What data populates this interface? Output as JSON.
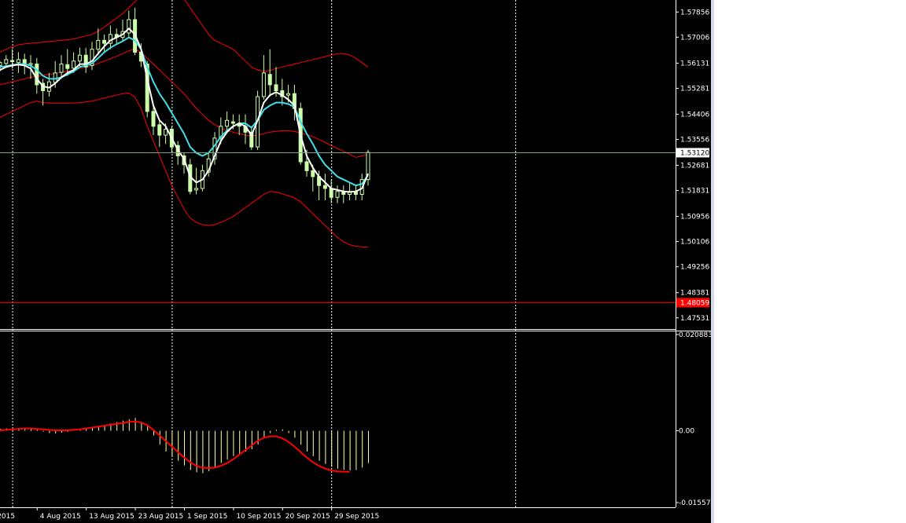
{
  "colors": {
    "background": "#000000",
    "foreground": "#ffffff",
    "grid": "#ffffff",
    "bull_candle": "#ccffaa",
    "bear_candle": "#ccffaa",
    "bollinger": "#ff0000",
    "ma_fast": "#ffffff",
    "ma_slow": "#40e0e8",
    "bid_line": "#7aa57a",
    "alert_line": "#ff0000",
    "alert_label_bg": "#ff0000",
    "bid_label_bg": "#ffffff",
    "macd_hist": "#ffffaa",
    "macd_signal": "#ff0000"
  },
  "chart_data": [
    {
      "type": "candlestick",
      "ylim": [
        1.4718,
        1.5805
      ],
      "price_ticks": [
        "1.57856",
        "1.57006",
        "1.56131",
        "1.55281",
        "1.54406",
        "1.53556",
        "1.52681",
        "1.51831",
        "1.50956",
        "1.50106",
        "1.49256",
        "1.48381",
        "1.47531"
      ],
      "bid_price": "1.53120",
      "alert_price": "1.48059",
      "x_labels": [
        {
          "text": "2015",
          "index": -1
        },
        {
          "text": "4 Aug 2015",
          "index": 6
        },
        {
          "text": "13 Aug 2015",
          "index": 14
        },
        {
          "text": "23 Aug 2015",
          "index": 22
        },
        {
          "text": "1 Sep 2015",
          "index": 30
        },
        {
          "text": "10 Sep 2015",
          "index": 38
        },
        {
          "text": "20 Sep 2015",
          "index": 46
        },
        {
          "text": "29 Sep 2015",
          "index": 54
        }
      ],
      "grid_indices": [
        2,
        28,
        54,
        84
      ],
      "bars": [
        [
          1.5605,
          1.5615,
          1.5585,
          1.562
        ],
        [
          1.5612,
          1.5625,
          1.56,
          1.564
        ],
        [
          1.5622,
          1.5618,
          1.5595,
          1.566
        ],
        [
          1.5615,
          1.5625,
          1.558,
          1.565
        ],
        [
          1.5625,
          1.561,
          1.5575,
          1.5645
        ],
        [
          1.5608,
          1.5612,
          1.556,
          1.564
        ],
        [
          1.561,
          1.554,
          1.551,
          1.563
        ],
        [
          1.5545,
          1.552,
          1.547,
          1.556
        ],
        [
          1.5518,
          1.555,
          1.55,
          1.558
        ],
        [
          1.5548,
          1.558,
          1.553,
          1.562
        ],
        [
          1.5582,
          1.561,
          1.556,
          1.564
        ],
        [
          1.5608,
          1.5595,
          1.557,
          1.566
        ],
        [
          1.5596,
          1.562,
          1.558,
          1.565
        ],
        [
          1.562,
          1.564,
          1.56,
          1.5665
        ],
        [
          1.564,
          1.56,
          1.558,
          1.5665
        ],
        [
          1.5605,
          1.566,
          1.559,
          1.5685
        ],
        [
          1.566,
          1.569,
          1.564,
          1.573
        ],
        [
          1.569,
          1.568,
          1.565,
          1.571
        ],
        [
          1.568,
          1.571,
          1.566,
          1.574
        ],
        [
          1.571,
          1.57,
          1.568,
          1.573
        ],
        [
          1.57,
          1.572,
          1.569,
          1.576
        ],
        [
          1.5715,
          1.576,
          1.57,
          1.579
        ],
        [
          1.576,
          1.565,
          1.564,
          1.58
        ],
        [
          1.565,
          1.562,
          1.56,
          1.568
        ],
        [
          1.561,
          1.545,
          1.543,
          1.562
        ],
        [
          1.545,
          1.54,
          1.537,
          1.547
        ],
        [
          1.5405,
          1.537,
          1.533,
          1.542
        ],
        [
          1.537,
          1.539,
          1.534,
          1.541
        ],
        [
          1.539,
          1.533,
          1.531,
          1.54
        ],
        [
          1.5335,
          1.53,
          1.527,
          1.535
        ],
        [
          1.53,
          1.527,
          1.524,
          1.531
        ],
        [
          1.527,
          1.518,
          1.517,
          1.529
        ],
        [
          1.5185,
          1.519,
          1.517,
          1.526
        ],
        [
          1.519,
          1.525,
          1.518,
          1.527
        ],
        [
          1.5245,
          1.529,
          1.523,
          1.531
        ],
        [
          1.529,
          1.536,
          1.527,
          1.538
        ],
        [
          1.536,
          1.54,
          1.534,
          1.543
        ],
        [
          1.54,
          1.542,
          1.538,
          1.545
        ],
        [
          1.5415,
          1.541,
          1.539,
          1.544
        ],
        [
          1.541,
          1.54,
          1.537,
          1.544
        ],
        [
          1.54,
          1.538,
          1.534,
          1.544
        ],
        [
          1.538,
          1.533,
          1.532,
          1.54
        ],
        [
          1.533,
          1.55,
          1.532,
          1.552
        ],
        [
          1.55,
          1.558,
          1.549,
          1.564
        ],
        [
          1.5575,
          1.554,
          1.55,
          1.566
        ],
        [
          1.554,
          1.552,
          1.55,
          1.56
        ],
        [
          1.552,
          1.55,
          1.547,
          1.556
        ],
        [
          1.5505,
          1.551,
          1.548,
          1.554
        ],
        [
          1.551,
          1.546,
          1.542,
          1.554
        ],
        [
          1.546,
          1.528,
          1.527,
          1.548
        ],
        [
          1.528,
          1.525,
          1.523,
          1.532
        ],
        [
          1.525,
          1.523,
          1.518,
          1.527
        ],
        [
          1.523,
          1.52,
          1.515,
          1.525
        ],
        [
          1.52,
          1.519,
          1.515,
          1.524
        ],
        [
          1.519,
          1.516,
          1.514,
          1.522
        ],
        [
          1.516,
          1.518,
          1.514,
          1.52
        ],
        [
          1.518,
          1.517,
          1.514,
          1.52
        ],
        [
          1.517,
          1.518,
          1.515,
          1.521
        ],
        [
          1.518,
          1.517,
          1.515,
          1.52
        ],
        [
          1.517,
          1.522,
          1.515,
          1.524
        ],
        [
          1.522,
          1.5312,
          1.52,
          1.532
        ]
      ],
      "ma_fast": [
        1.559,
        1.56,
        1.5605,
        1.5608,
        1.5605,
        1.5595,
        1.556,
        1.5535,
        1.553,
        1.5545,
        1.5565,
        1.558,
        1.559,
        1.561,
        1.561,
        1.562,
        1.5645,
        1.567,
        1.569,
        1.57,
        1.571,
        1.573,
        1.571,
        1.566,
        1.556,
        1.547,
        1.542,
        1.54,
        1.536,
        1.532,
        1.529,
        1.523,
        1.521,
        1.522,
        1.525,
        1.53,
        1.535,
        1.538,
        1.54,
        1.541,
        1.54,
        1.537,
        1.542,
        1.548,
        1.5505,
        1.5515,
        1.5505,
        1.549,
        1.547,
        1.537,
        1.53,
        1.526,
        1.523,
        1.521,
        1.519,
        1.5185,
        1.518,
        1.5178,
        1.518,
        1.519,
        1.524
      ],
      "ma_slow": [
        1.56,
        1.5603,
        1.5607,
        1.561,
        1.561,
        1.5605,
        1.559,
        1.557,
        1.556,
        1.556,
        1.5565,
        1.5575,
        1.5585,
        1.56,
        1.5605,
        1.5612,
        1.563,
        1.565,
        1.5665,
        1.5677,
        1.5687,
        1.57,
        1.569,
        1.566,
        1.56,
        1.555,
        1.551,
        1.548,
        1.5445,
        1.541,
        1.5375,
        1.533,
        1.531,
        1.53,
        1.531,
        1.5335,
        1.5365,
        1.5385,
        1.54,
        1.541,
        1.541,
        1.5395,
        1.542,
        1.5455,
        1.547,
        1.548,
        1.548,
        1.5475,
        1.5465,
        1.5415,
        1.5375,
        1.534,
        1.53,
        1.527,
        1.525,
        1.523,
        1.522,
        1.521,
        1.52,
        1.5205,
        1.5235
      ],
      "bb_upper": [
        1.565,
        1.566,
        1.5668,
        1.5675,
        1.5678,
        1.568,
        1.5682,
        1.5684,
        1.5686,
        1.5688,
        1.569,
        1.5692,
        1.5695,
        1.57,
        1.5705,
        1.571,
        1.572,
        1.5735,
        1.575,
        1.5765,
        1.578,
        1.58,
        1.582,
        1.584,
        1.5858,
        1.5868,
        1.587,
        1.5868,
        1.586,
        1.5845,
        1.583,
        1.58,
        1.577,
        1.574,
        1.571,
        1.569,
        1.568,
        1.567,
        1.566,
        1.564,
        1.562,
        1.56,
        1.559,
        1.5585,
        1.5588,
        1.5595,
        1.56,
        1.5605,
        1.561,
        1.5615,
        1.562,
        1.5625,
        1.563,
        1.5635,
        1.564,
        1.5645,
        1.5645,
        1.564,
        1.563,
        1.5615,
        1.56
      ],
      "bb_mid": [
        1.554,
        1.5545,
        1.555,
        1.5555,
        1.556,
        1.5565,
        1.557,
        1.5572,
        1.5575,
        1.5578,
        1.5582,
        1.5585,
        1.559,
        1.5595,
        1.56,
        1.5605,
        1.5612,
        1.562,
        1.5628,
        1.5636,
        1.5645,
        1.5655,
        1.566,
        1.565,
        1.563,
        1.561,
        1.559,
        1.557,
        1.555,
        1.553,
        1.551,
        1.5485,
        1.546,
        1.544,
        1.542,
        1.5405,
        1.5395,
        1.5385,
        1.538,
        1.5375,
        1.537,
        1.5368,
        1.537,
        1.5375,
        1.538,
        1.5383,
        1.5385,
        1.5385,
        1.5382,
        1.5378,
        1.5372,
        1.5365,
        1.5355,
        1.5345,
        1.5335,
        1.5325,
        1.5315,
        1.5305,
        1.5295,
        1.53,
        1.5305
      ],
      "bb_lower": [
        1.543,
        1.544,
        1.545,
        1.546,
        1.547,
        1.548,
        1.5485,
        1.548,
        1.5478,
        1.5478,
        1.5478,
        1.5478,
        1.5478,
        1.548,
        1.5482,
        1.5485,
        1.549,
        1.5495,
        1.55,
        1.5505,
        1.551,
        1.5512,
        1.5498,
        1.546,
        1.54,
        1.535,
        1.53,
        1.525,
        1.52,
        1.516,
        1.512,
        1.509,
        1.5075,
        1.5068,
        1.5065,
        1.5068,
        1.5075,
        1.5085,
        1.5095,
        1.511,
        1.5125,
        1.514,
        1.5155,
        1.517,
        1.518,
        1.5178,
        1.5172,
        1.5165,
        1.5158,
        1.5145,
        1.5125,
        1.5105,
        1.5085,
        1.5065,
        1.5045,
        1.5025,
        1.501,
        1.5,
        1.4995,
        1.4993,
        1.4992
      ]
    },
    {
      "type": "histogram",
      "ylim": [
        -0.015576,
        0.020883
      ],
      "ticks": [
        "0.020883",
        "0.00",
        "-0.015576"
      ],
      "tick_values": [
        0.020883,
        0.0,
        -0.015576
      ],
      "macd_hist": [
        0.0004,
        0.0005,
        0.0006,
        0.0006,
        0.0005,
        0.0004,
        0.0003,
        -0.0002,
        -0.0005,
        -0.0006,
        -0.0004,
        -0.0002,
        0.0001,
        0.0003,
        0.0005,
        0.0007,
        0.001,
        0.0013,
        0.0016,
        0.0019,
        0.0022,
        0.0025,
        0.0028,
        0.002,
        0.001,
        -0.001,
        -0.003,
        -0.0045,
        -0.0055,
        -0.0065,
        -0.0075,
        -0.0085,
        -0.009,
        -0.0092,
        -0.0088,
        -0.008,
        -0.007,
        -0.0062,
        -0.0055,
        -0.005,
        -0.0045,
        -0.004,
        -0.003,
        -0.0015,
        -0.0005,
        0.0002,
        0.0003,
        -0.0005,
        -0.0015,
        -0.003,
        -0.0045,
        -0.0055,
        -0.0065,
        -0.0072,
        -0.0078,
        -0.0082,
        -0.0085,
        -0.0086,
        -0.0085,
        -0.008,
        -0.007
      ],
      "macd_signal": [
        0.0001,
        0.0002,
        0.0003,
        0.0004,
        0.0005,
        0.0005,
        0.0004,
        0.0003,
        0.0002,
        0.0001,
        0.0001,
        0.0001,
        0.0002,
        0.0003,
        0.0005,
        0.0007,
        0.0009,
        0.0011,
        0.0013,
        0.0015,
        0.0017,
        0.0019,
        0.002,
        0.0018,
        0.0012,
        0.0002,
        -0.001,
        -0.0022,
        -0.0034,
        -0.0046,
        -0.0058,
        -0.0068,
        -0.0076,
        -0.008,
        -0.0081,
        -0.008,
        -0.0076,
        -0.007,
        -0.0062,
        -0.0052,
        -0.0042,
        -0.0032,
        -0.0022,
        -0.0015,
        -0.0012,
        -0.0012,
        -0.0016,
        -0.0024,
        -0.0034,
        -0.0046,
        -0.0058,
        -0.0068,
        -0.0076,
        -0.0082,
        -0.0086,
        -0.0088,
        -0.0089,
        -0.0089
      ]
    }
  ]
}
